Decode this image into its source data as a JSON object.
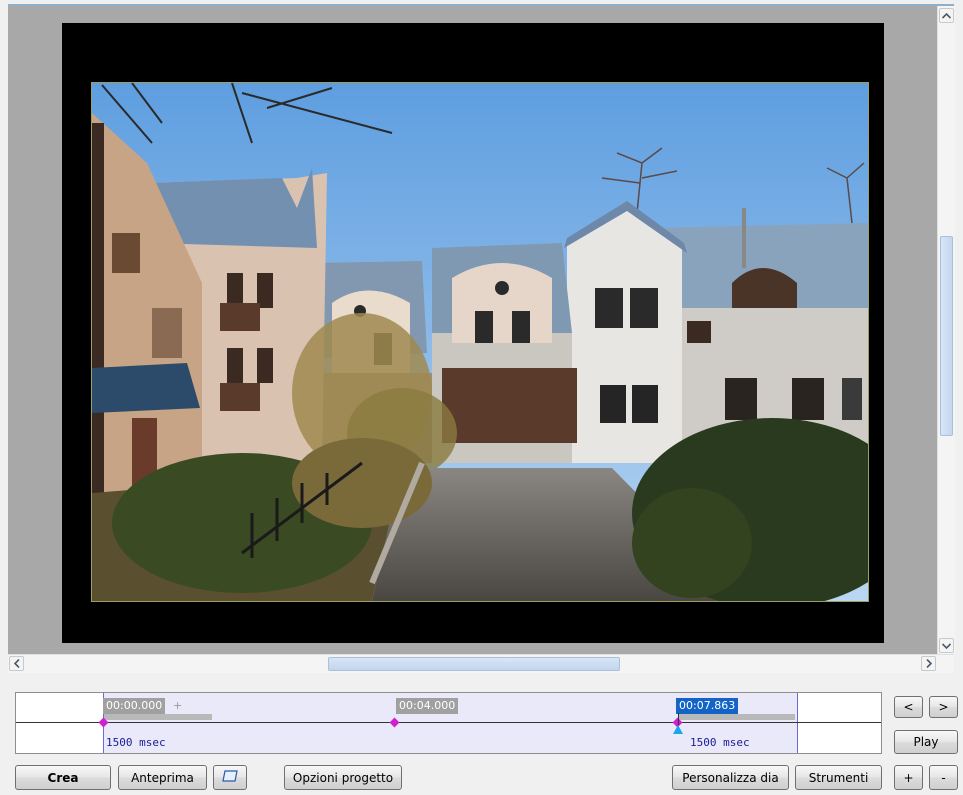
{
  "preview": {
    "image_icon": "photo-of-building-courtyard"
  },
  "scroll": {
    "up_icon": "chevron-up-icon",
    "down_icon": "chevron-down-icon",
    "left_icon": "chevron-left-icon",
    "right_icon": "chevron-right-icon"
  },
  "timeline": {
    "start_time": "00:00.000",
    "plus_mark": "+",
    "mid_time": "00:04.000",
    "current_time": "00:07.863",
    "duration_start": "1500 msec",
    "duration_end": "1500 msec",
    "colors": {
      "region": "#e9e9f9",
      "keyframe": "#d020d0",
      "selected_time": "#1464c8",
      "cursor": "#18a8e8"
    }
  },
  "nav": {
    "prev": "<",
    "next": ">",
    "play": "Play",
    "zoom_in": "+",
    "zoom_out": "-"
  },
  "toolbar": {
    "create": "Crea",
    "preview": "Anteprima",
    "fullscreen_icon": "screen-icon",
    "project_options": "Opzioni progetto",
    "customize_slide": "Personalizza dia",
    "tools": "Strumenti"
  }
}
